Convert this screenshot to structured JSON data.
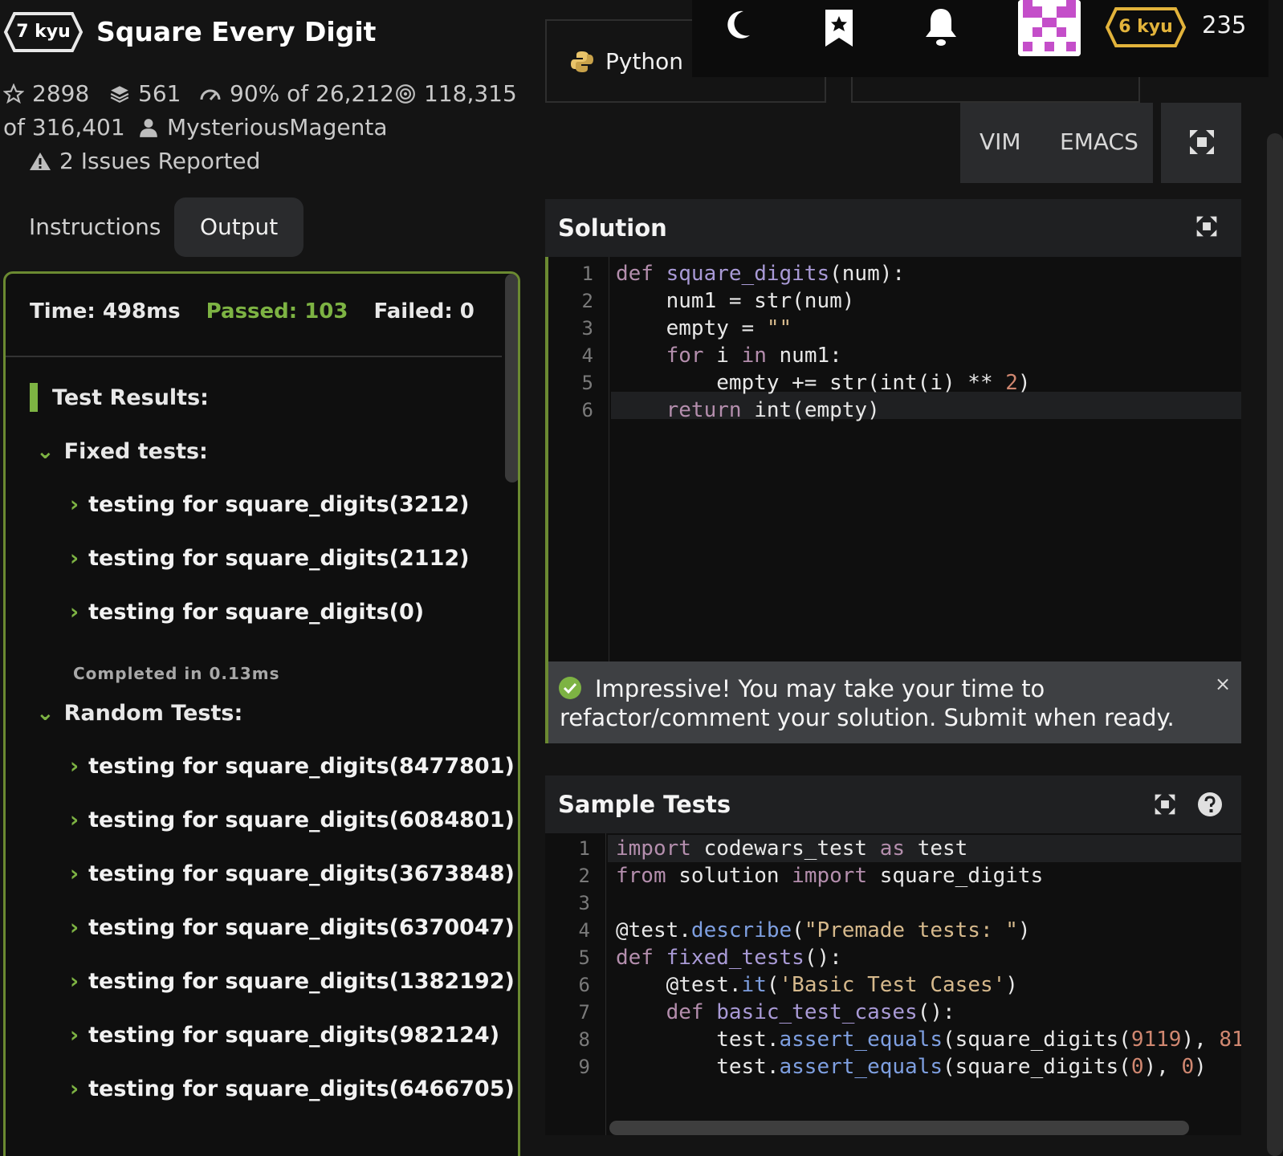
{
  "kata": {
    "kyu": "7 kyu",
    "title": "Square Every Digit",
    "stars": "2898",
    "collections": "561",
    "satisfaction": "90% of 26,212",
    "completed": "118,315",
    "attempts": "of 316,401",
    "author": "MysteriousMagenta",
    "issues": "2 Issues Reported"
  },
  "tabs": [
    "Instructions",
    "Output"
  ],
  "output": {
    "time": "Time: 498ms",
    "passed": "Passed: 103",
    "failed": "Failed: 0",
    "results_label": "Test Results:",
    "fixed_label": "Fixed tests:",
    "fixed_tests": [
      "testing for square_digits(3212)",
      "testing for square_digits(2112)",
      "testing for square_digits(0)"
    ],
    "completed": "Completed in 0.13ms",
    "random_label": "Random Tests:",
    "random_tests": [
      "testing for square_digits(8477801)",
      "testing for square_digits(6084801)",
      "testing for square_digits(3673848)",
      "testing for square_digits(6370047)",
      "testing for square_digits(1382192)",
      "testing for square_digits(982124)",
      "testing for square_digits(6466705)"
    ]
  },
  "nav": {
    "language": "Python",
    "rank": "6 kyu",
    "honor": "235",
    "icons": [
      "moon-icon",
      "bookmark-star-icon",
      "bell-icon"
    ]
  },
  "editor_modes": [
    "VIM",
    "EMACS"
  ],
  "solution": {
    "title": "Solution",
    "line_numbers": [
      "1",
      "2",
      "3",
      "4",
      "5",
      "6"
    ],
    "banner": "Impressive! You may take your time to refactor/comment your solution. Submit when ready.",
    "banner_close": "×"
  },
  "sample_tests": {
    "title": "Sample Tests",
    "line_numbers": [
      "1",
      "2",
      "3",
      "4",
      "5",
      "6",
      "7",
      "8",
      "9"
    ]
  },
  "colors": {
    "accent_green": "#7db343",
    "panel_border": "#6b8a31",
    "rank_gold": "#e2b33b",
    "avatar_magenta": "#c44ec9"
  }
}
